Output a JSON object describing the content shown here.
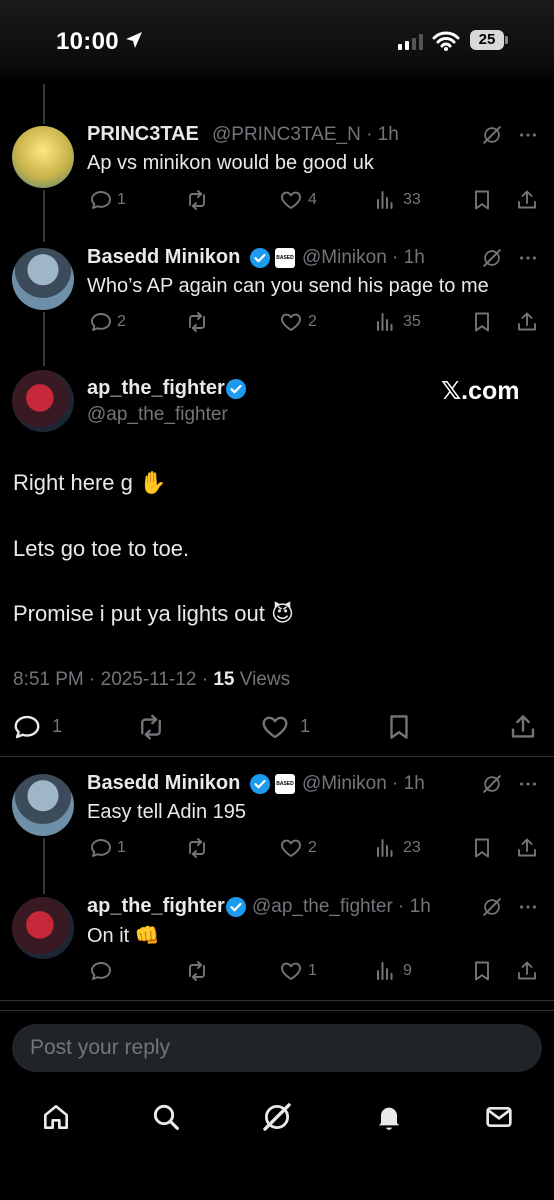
{
  "status": {
    "time": "10:00",
    "battery": "25"
  },
  "replies": [
    {
      "name": "PRINC3TAE",
      "handle": "@PRINC3TAE_N · 1h",
      "text": "Ap vs minikon would be good uk",
      "replies": "1",
      "likes": "4",
      "views": "33"
    },
    {
      "name": "Basedd Minikon",
      "badge_text": "BASED",
      "handle": "@Minikon · 1h",
      "text": "Who’s AP again can you send his page to me",
      "replies": "2",
      "likes": "2",
      "views": "35"
    }
  ],
  "main_post": {
    "name": "ap_the_fighter",
    "handle": "@ap_the_fighter",
    "watermark": "𝕏.com",
    "line1": "Right here g ✋",
    "line2": "Lets go toe to toe.",
    "line3": "Promise i put ya lights out 😈",
    "timestamp": "8:51 PM · 2025-11-12 ·",
    "views_count": "15",
    "views_label": "Views",
    "replies": "1",
    "likes": "1"
  },
  "below": [
    {
      "name": "Basedd Minikon",
      "badge_text": "BASED",
      "handle": "@Minikon · 1h",
      "text": "Easy tell Adin 195",
      "replies": "1",
      "likes": "2",
      "views": "23"
    },
    {
      "name": "ap_the_fighter",
      "handle": "@ap_the_fighter · 1h",
      "text": "On it 👊",
      "replies": "",
      "likes": "1",
      "views": "9"
    }
  ],
  "reply_box": {
    "placeholder": "Post your reply"
  },
  "icons": {
    "reply": "reply-icon",
    "repost": "repost-icon",
    "like": "like-icon",
    "views": "views-icon",
    "bookmark": "bookmark-icon",
    "share": "share-icon",
    "grok": "grok-icon",
    "more": "more-icon",
    "tabs": [
      "home-icon",
      "search-icon",
      "grok-icon",
      "notifications-icon",
      "messages-icon"
    ]
  },
  "colors": {
    "background": "#000000",
    "text": "#e7e9ea",
    "secondary": "#71767b",
    "verified": "#1d9bf0",
    "divider": "#2f3336"
  }
}
